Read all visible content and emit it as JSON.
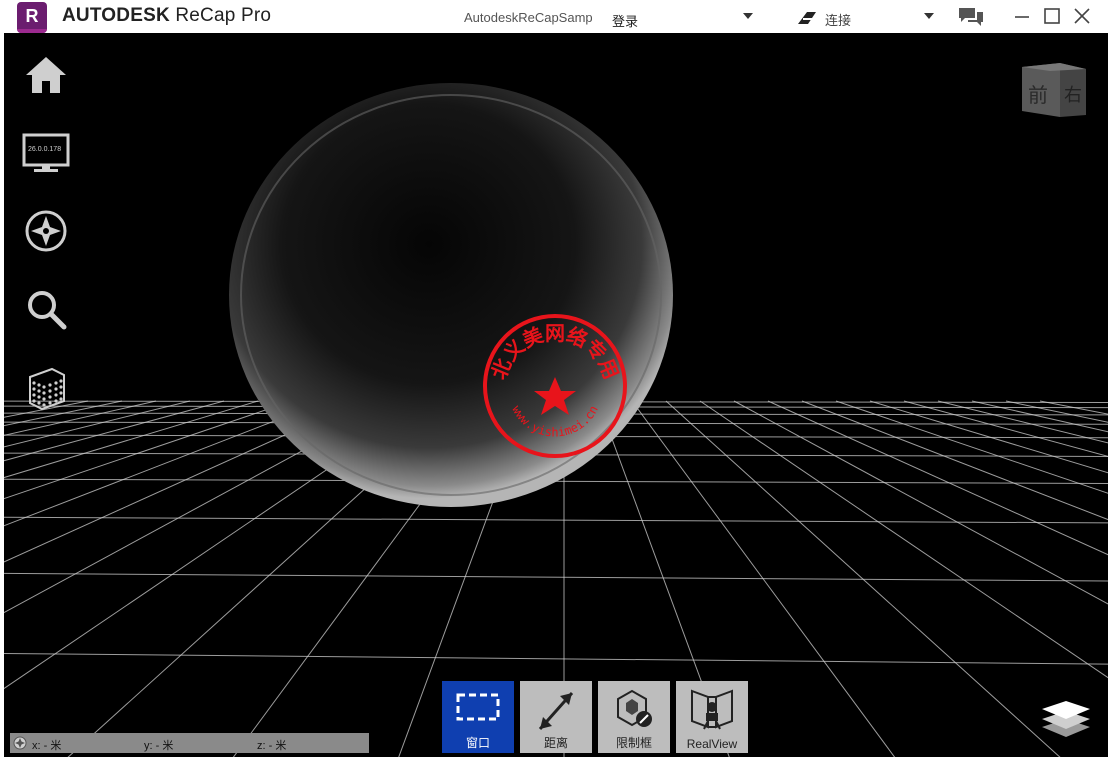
{
  "titlebar": {
    "logo_letter": "R",
    "app_brand": "AUTODESK",
    "app_product": "ReCap Pro",
    "file_name": "AutodeskReCapSample",
    "login_label": "登录",
    "connect_label": "连接"
  },
  "left_toolbar": {
    "version_text": "26.0.0.178"
  },
  "view_cube": {
    "front_label": "前",
    "right_label": "右"
  },
  "bottom_tools": [
    {
      "label": "窗口",
      "icon": "window-select-icon",
      "active": true
    },
    {
      "label": "距离",
      "icon": "distance-measure-icon",
      "active": false
    },
    {
      "label": "限制框",
      "icon": "limit-box-icon",
      "active": false
    },
    {
      "label": "RealView",
      "icon": "realview-icon",
      "active": false
    }
  ],
  "coordinates": {
    "x_label": "x:  - 米",
    "y_label": "y:  - 米",
    "z_label": "z:  - 米"
  },
  "watermark": {
    "stamp_top": "淮北义美网络专用章",
    "stamp_bottom": "www.yishimei.cn",
    "color": "#e8141b"
  },
  "colors": {
    "active_tool": "#0f3fb0",
    "tool_bg": "#bdbdbd",
    "viewport_bg": "#000000",
    "logo": "#6b1d6f"
  }
}
